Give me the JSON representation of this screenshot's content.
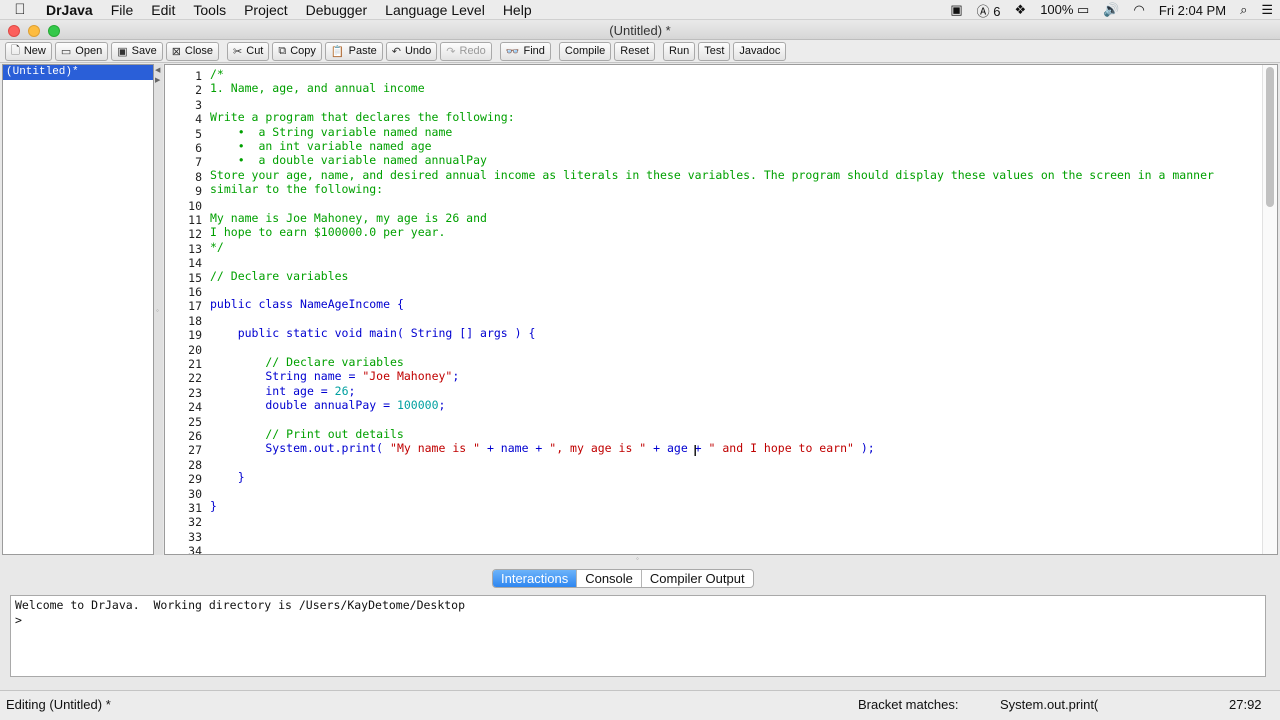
{
  "menubar": {
    "app_name": "DrJava",
    "items": [
      "File",
      "Edit",
      "Tools",
      "Project",
      "Debugger",
      "Language Level",
      "Help"
    ],
    "status": {
      "adobe_count": "6",
      "battery": "100%",
      "clock": "Fri 2:04 PM"
    }
  },
  "window": {
    "title": "(Untitled) *"
  },
  "toolbar": {
    "new": "New",
    "open": "Open",
    "save": "Save",
    "close": "Close",
    "cut": "Cut",
    "copy": "Copy",
    "paste": "Paste",
    "undo": "Undo",
    "redo": "Redo",
    "find": "Find",
    "compile": "Compile",
    "reset": "Reset",
    "run": "Run",
    "test": "Test",
    "javadoc": "Javadoc"
  },
  "files": {
    "selected": "(Untitled)*"
  },
  "editor": {
    "line_numbers": [
      "1",
      "2",
      "3",
      "4",
      "5",
      "6",
      "7",
      "8",
      "9",
      "10",
      "11",
      "12",
      "13",
      "14",
      "15",
      "16",
      "17",
      "18",
      "19",
      "20",
      "21",
      "22",
      "23",
      "24",
      "25",
      "26",
      "27",
      "28",
      "29",
      "30",
      "31",
      "32",
      "33",
      "34"
    ],
    "code": {
      "l1": "/*",
      "l2": "1. Name, age, and annual income",
      "l4": "Write a program that declares the following:",
      "l5": "    •  a String variable named name",
      "l6": "    •  an int variable named age",
      "l7": "    •  a double variable named annualPay",
      "l8": "Store your age, name, and desired annual income as literals in these variables. The program should display these values on the screen in a manner",
      "l9": "similar to the following:",
      "l11": "My name is Joe Mahoney, my age is 26 and",
      "l12": "I hope to earn $100000.0 per year.",
      "l13": "*/",
      "l15": "// Declare variables",
      "l17_kw": "public class",
      "l17_name": " NameAgeIncome {",
      "l19_kw": "    public static void",
      "l19_rest": " main( ",
      "l19_type": "String",
      "l19_end": " [] args ) {",
      "l21": "        // Declare variables",
      "l22_type": "        String",
      "l22_mid": " name = ",
      "l22_str": "\"Joe Mahoney\"",
      "l22_end": ";",
      "l23_type": "        int",
      "l23_mid": " age = ",
      "l23_num": "26",
      "l23_end": ";",
      "l24_type": "        double",
      "l24_mid": " annualPay = ",
      "l24_num": "100000",
      "l24_end": ";",
      "l26": "        // Print out details",
      "l27_a": "        System.out.print( ",
      "l27_s1": "\"My name is \"",
      "l27_b": " + name + ",
      "l27_s2": "\", my age is \"",
      "l27_c": " + age + ",
      "l27_s3": "\" and I hope to earn\"",
      "l27_d": " );",
      "l29": "    }",
      "l31": "}"
    }
  },
  "bottom": {
    "tabs": [
      "Interactions",
      "Console",
      "Compiler Output"
    ],
    "active_tab": "Interactions",
    "welcome": "Welcome to DrJava.  Working directory is /Users/KayDetome/Desktop",
    "prompt": ">"
  },
  "status": {
    "editing": "Editing (Untitled) *",
    "bracket_label": "Bracket matches:",
    "bracket_value": "System.out.print(",
    "position": "27:92"
  }
}
